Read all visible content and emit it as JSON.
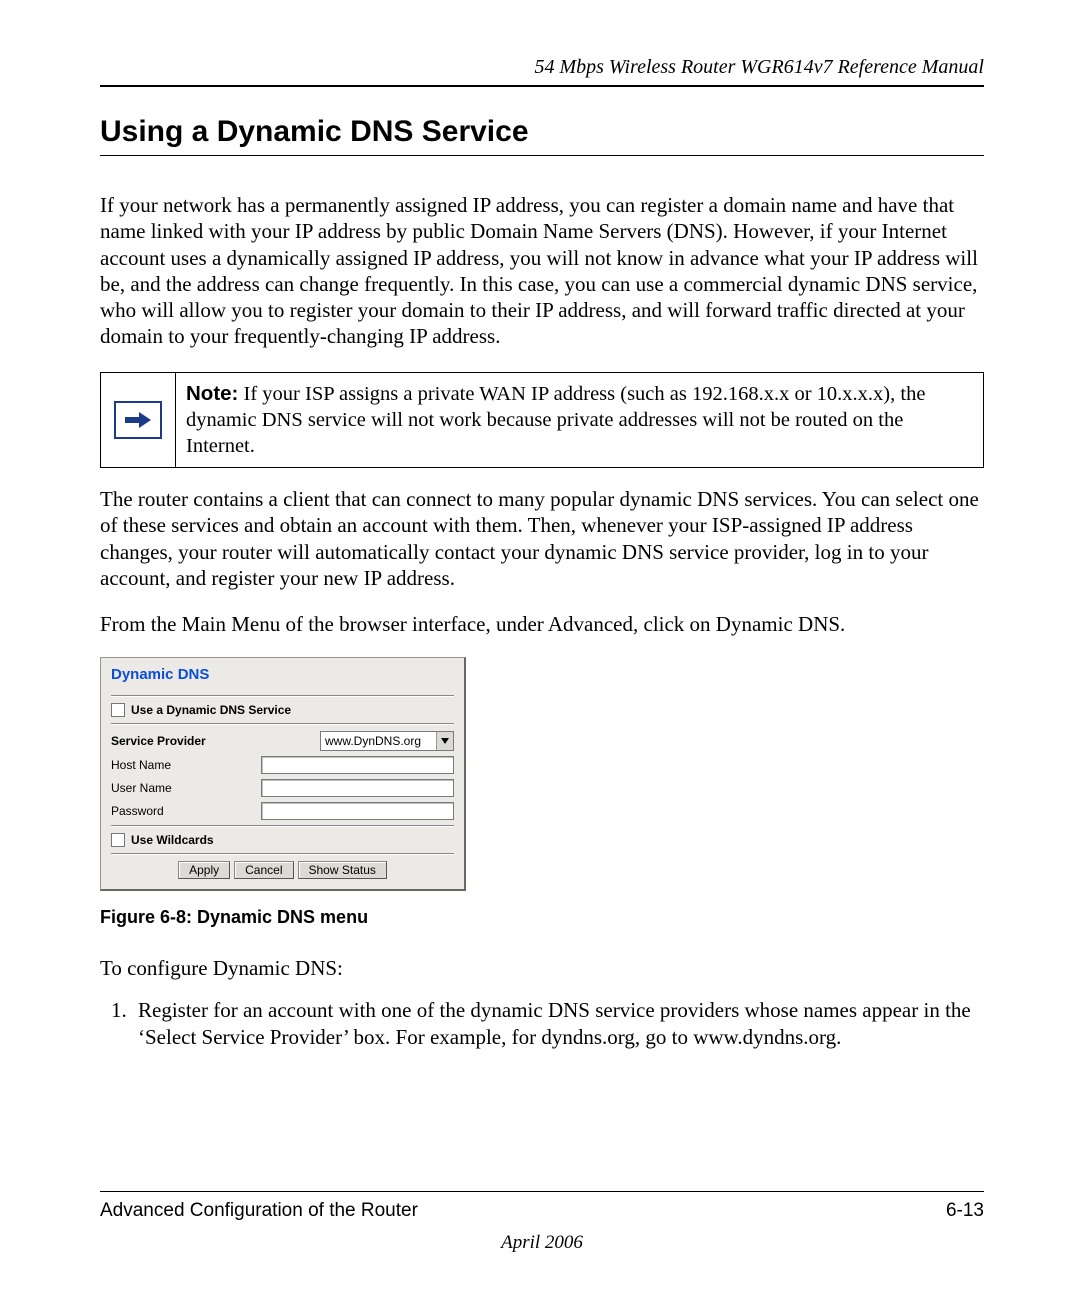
{
  "header": {
    "running_title": "54 Mbps Wireless Router WGR614v7 Reference Manual"
  },
  "section": {
    "title": "Using a Dynamic DNS Service",
    "para1": "If your network has a permanently assigned IP address, you can register a domain name and have that name linked with your IP address by public Domain Name Servers (DNS). However, if your Internet account uses a dynamically assigned IP address, you will not know in advance what your IP address will be, and the address can change frequently. In this case, you can use a commercial dynamic DNS service, who will allow you to register your domain to their IP address, and will forward traffic directed at your domain to your frequently-changing IP address.",
    "note_label": "Note:",
    "note_text": " If your ISP assigns a private WAN IP address (such as 192.168.x.x or 10.x.x.x), the dynamic DNS service will not work because private addresses will not be routed on the Internet.",
    "para2": "The router contains a client that can connect to many popular dynamic DNS services. You can select one of these services and obtain an account with them. Then, whenever your ISP-assigned IP address changes, your router will automatically contact your dynamic DNS service provider, log in to your account, and register your new IP address.",
    "para3": "From the Main Menu of the browser interface, under Advanced, click on Dynamic DNS."
  },
  "figure": {
    "panel_title": "Dynamic DNS",
    "use_service_label": "Use a Dynamic DNS Service",
    "service_provider_label": "Service Provider",
    "service_provider_value": "www.DynDNS.org",
    "host_name_label": "Host Name",
    "user_name_label": "User Name",
    "password_label": "Password",
    "use_wildcards_label": "Use Wildcards",
    "buttons": {
      "apply": "Apply",
      "cancel": "Cancel",
      "show_status": "Show Status"
    },
    "caption": "Figure 6-8:  Dynamic DNS menu"
  },
  "closing": {
    "lead_in": "To configure Dynamic DNS:",
    "step1": "Register for an account with one of the dynamic DNS service providers whose names appear in the ‘Select Service Provider’ box. For example, for dyndns.org, go to www.dyndns.org."
  },
  "footer": {
    "left": "Advanced Configuration of the Router",
    "right": "6-13",
    "date": "April 2006"
  }
}
